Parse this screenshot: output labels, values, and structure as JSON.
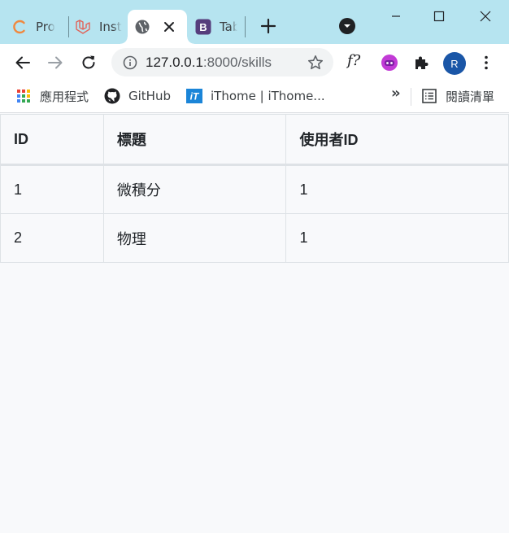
{
  "tabs": [
    {
      "title": "Pro",
      "icon": "progress-ring-icon"
    },
    {
      "title": "Inst",
      "icon": "laravel-icon"
    },
    {
      "title": "",
      "icon": "globe-icon",
      "active": true
    },
    {
      "title": "Tab",
      "icon": "bootstrap-icon"
    }
  ],
  "address_bar": {
    "host": "127.0.0.1",
    "path": ":8000/skills"
  },
  "toolbar": {
    "fx_label": "f?",
    "avatar_initial": "R"
  },
  "bookmarks": {
    "items": [
      {
        "label": "應用程式",
        "icon": "apps-grid-icon"
      },
      {
        "label": "GitHub",
        "icon": "github-icon"
      },
      {
        "label": "iThome | iThome...",
        "icon": "ithome-icon"
      }
    ],
    "more": "»",
    "reading_list": "閱讀清單"
  },
  "table": {
    "headers": [
      "ID",
      "標題",
      "使用者ID"
    ],
    "rows": [
      [
        "1",
        "微積分",
        "1"
      ],
      [
        "2",
        "物理",
        "1"
      ]
    ]
  },
  "colors": {
    "tabstrip_bg": "#b6e4f0",
    "page_bg": "#f8f9fb",
    "avatar_bg": "#1a56a7",
    "table_border": "#dee2e6"
  }
}
